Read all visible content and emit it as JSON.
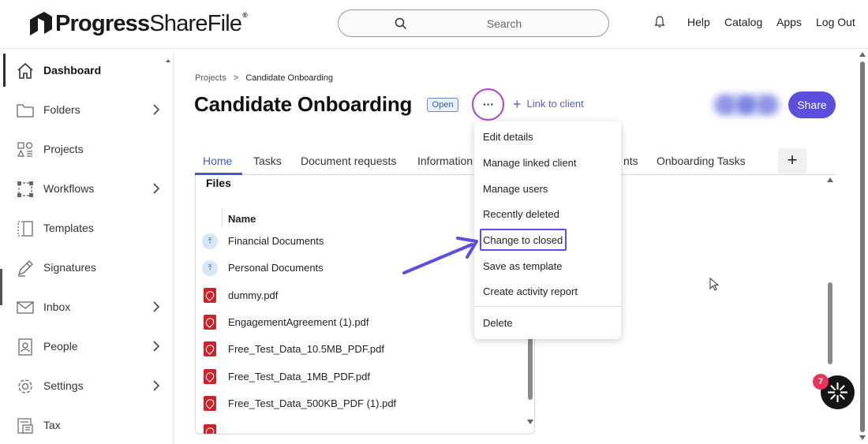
{
  "brand": {
    "name_bold": "Progress",
    "name_thin": "ShareFile",
    "trademark": "®"
  },
  "search": {
    "placeholder": "Search"
  },
  "topnav": {
    "help": "Help",
    "catalog": "Catalog",
    "apps": "Apps",
    "logout": "Log Out"
  },
  "sidebar": {
    "items": [
      {
        "label": "Dashboard",
        "icon": "home-icon",
        "chevron": false,
        "active": true
      },
      {
        "label": "Folders",
        "icon": "folder-icon",
        "chevron": true
      },
      {
        "label": "Projects",
        "icon": "projects-icon",
        "chevron": false
      },
      {
        "label": "Workflows",
        "icon": "workflows-icon",
        "chevron": true
      },
      {
        "label": "Templates",
        "icon": "templates-icon",
        "chevron": false
      },
      {
        "label": "Signatures",
        "icon": "pen-icon",
        "chevron": false
      },
      {
        "label": "Inbox",
        "icon": "mail-icon",
        "chevron": true
      },
      {
        "label": "People",
        "icon": "person-icon",
        "chevron": true
      },
      {
        "label": "Settings",
        "icon": "gear-icon",
        "chevron": true
      },
      {
        "label": "Tax",
        "icon": "tax-icon",
        "chevron": false
      }
    ]
  },
  "breadcrumb": {
    "parent": "Projects",
    "separator": ">",
    "current": "Candidate Onboarding"
  },
  "project": {
    "title": "Candidate Onboarding",
    "status": "Open",
    "more": "···",
    "link_client": "Link to client",
    "share": "Share"
  },
  "tabs": [
    {
      "label": "Home",
      "active": true
    },
    {
      "label": "Tasks"
    },
    {
      "label": "Document requests"
    },
    {
      "label": "Information"
    },
    {
      "label": "nts"
    },
    {
      "label": "Onboarding Tasks"
    }
  ],
  "add_tab": "+",
  "files": {
    "title": "Files",
    "column_name": "Name",
    "rows": [
      {
        "name": "Financial Documents",
        "type": "folder"
      },
      {
        "name": "Personal Documents",
        "type": "folder"
      },
      {
        "name": "dummy.pdf",
        "type": "pdf"
      },
      {
        "name": "EngagementAgreement (1).pdf",
        "type": "pdf"
      },
      {
        "name": "Free_Test_Data_10.5MB_PDF.pdf",
        "type": "pdf"
      },
      {
        "name": "Free_Test_Data_1MB_PDF.pdf",
        "type": "pdf"
      },
      {
        "name": "Free_Test_Data_500KB_PDF (1).pdf",
        "type": "pdf"
      }
    ]
  },
  "menu": {
    "items": [
      "Edit details",
      "Manage linked client",
      "Manage users",
      "Recently deleted",
      "Change to closed",
      "Save as template",
      "Create activity report"
    ],
    "danger_item": "Delete",
    "highlighted": "Change to closed"
  },
  "chat": {
    "badge": "7"
  },
  "colors": {
    "accent": "#5b4fe0",
    "link": "#5b5bd8",
    "tab_active": "#3e5bd0",
    "more_ring": "#b13fd9",
    "pdf": "#c8262b",
    "badge": "#e8335b"
  }
}
